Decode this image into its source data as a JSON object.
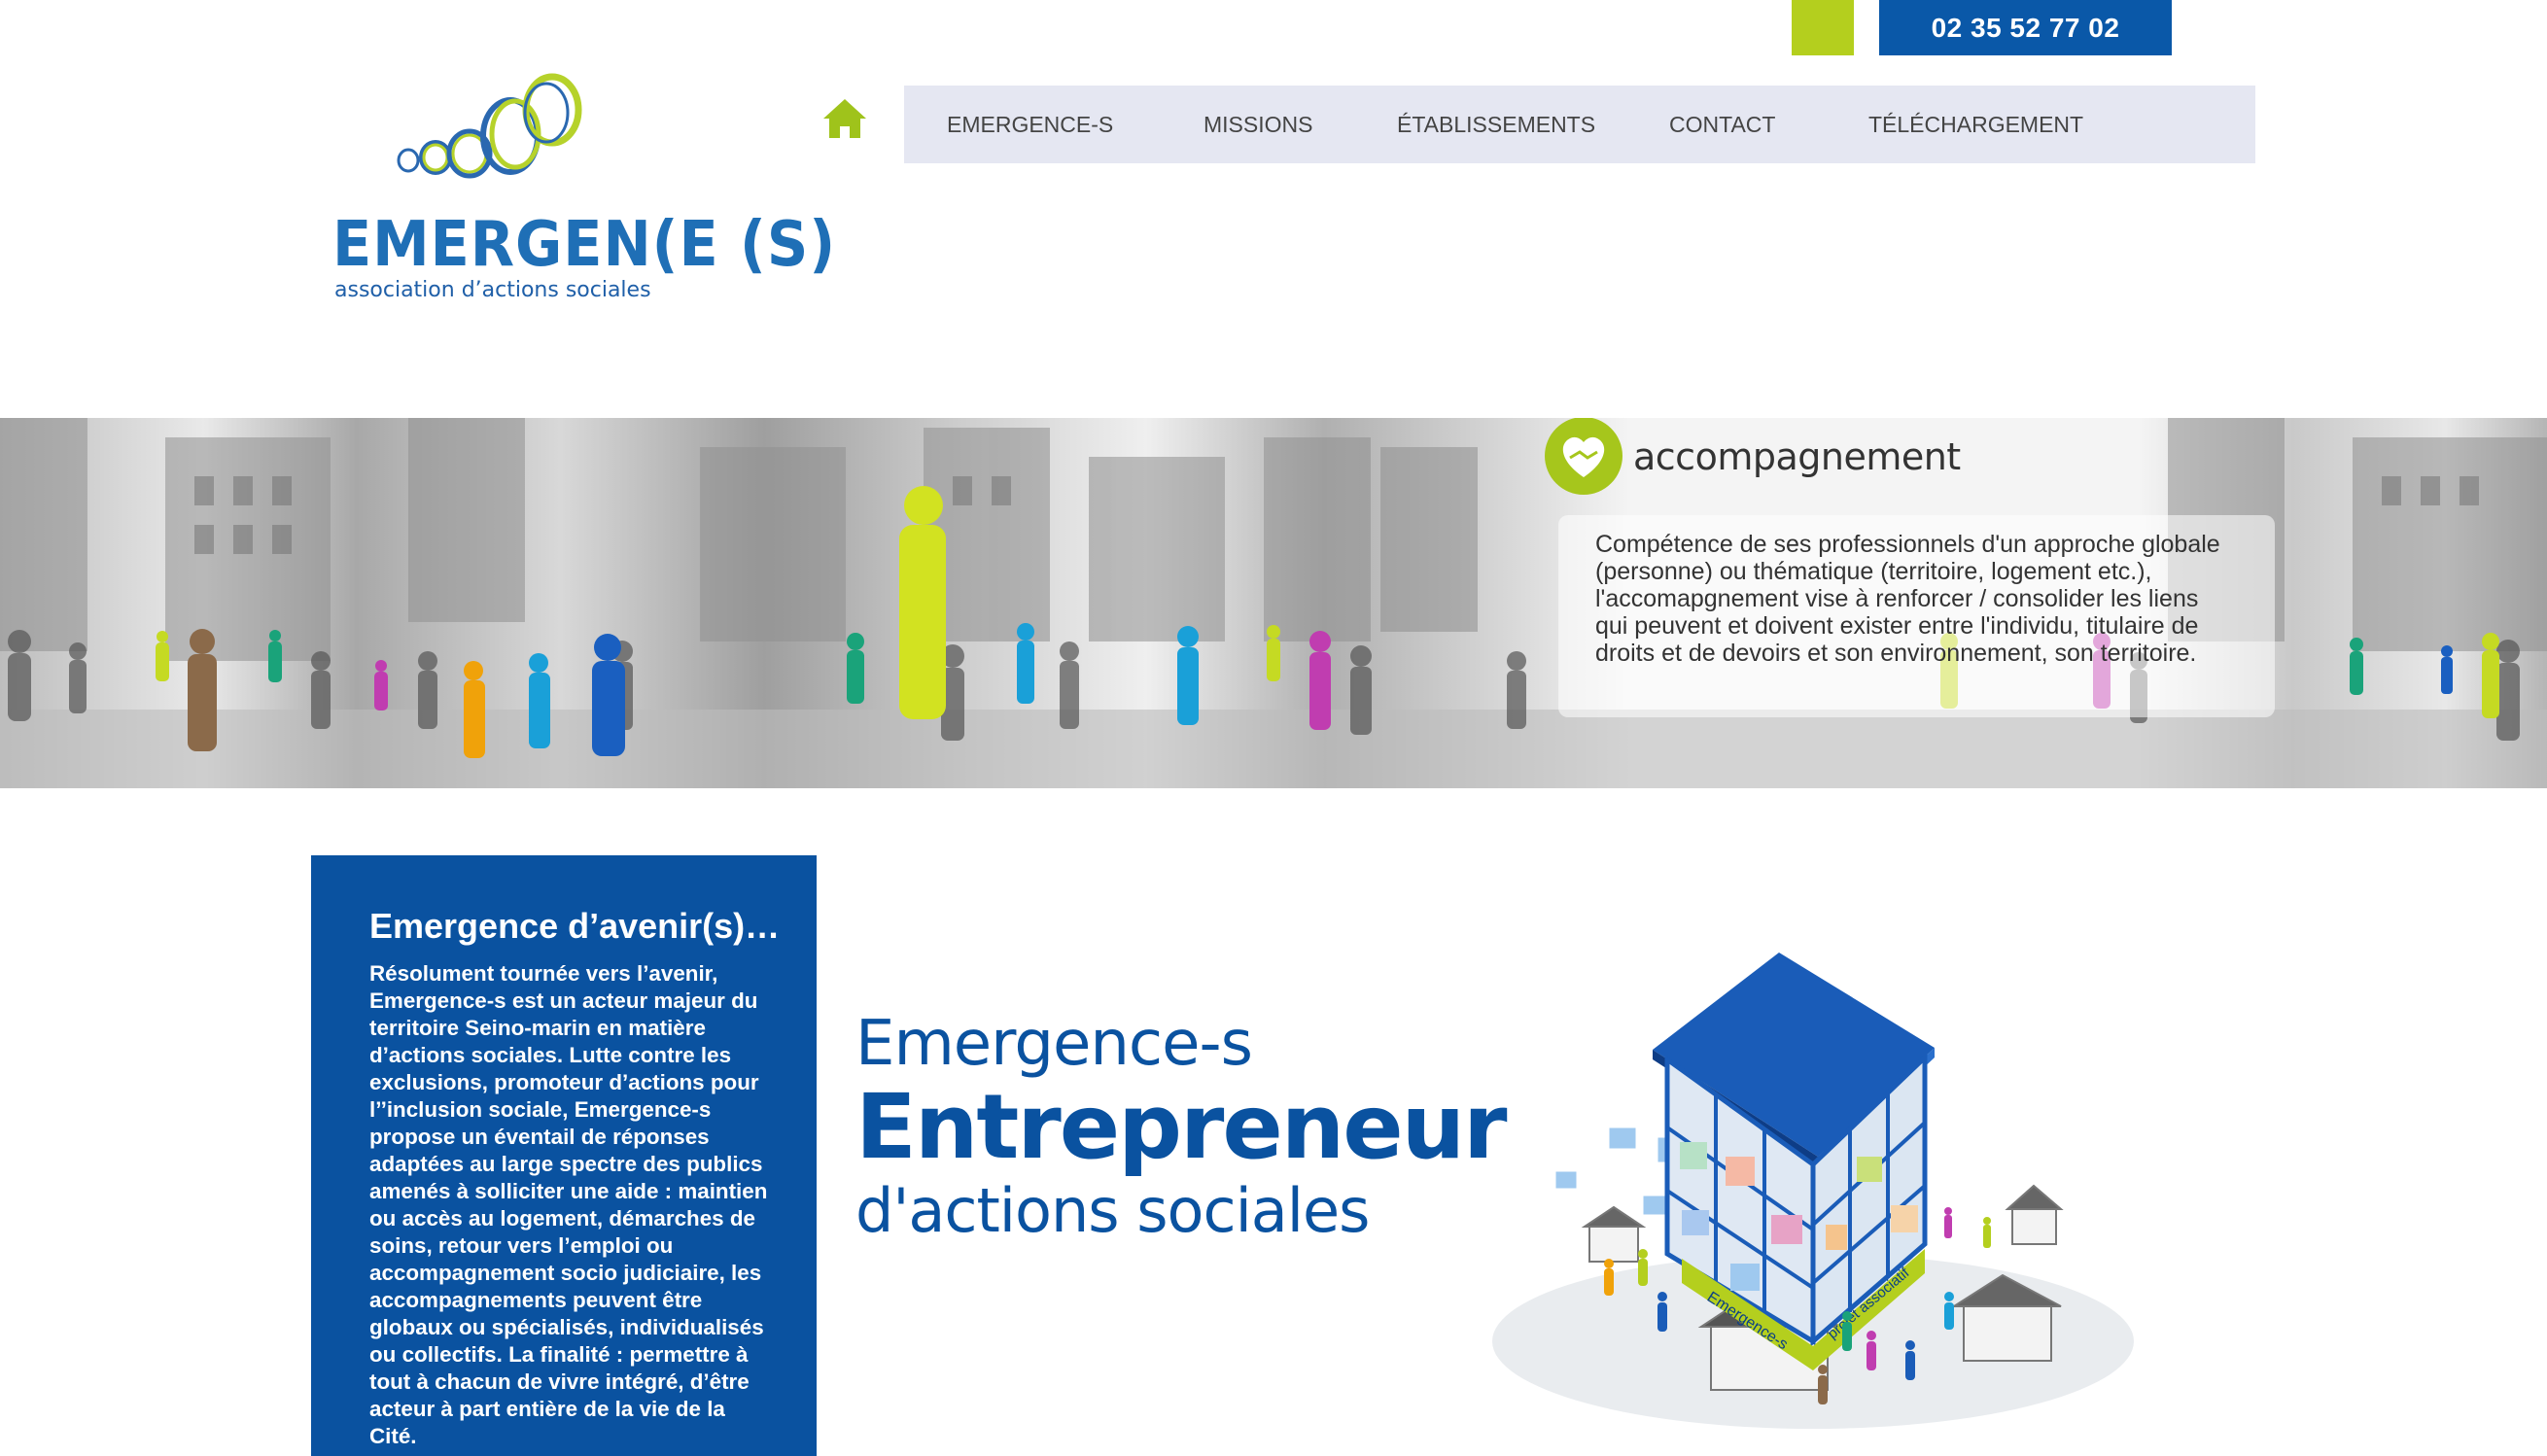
{
  "header": {
    "phone": "02 35 52 77 02",
    "accent_color": "#b4cf1e",
    "brand_blue": "#0a58a8"
  },
  "logo": {
    "wordmark": "EMERGEN(E (S)",
    "tagline": "association d’actions sociales"
  },
  "nav": {
    "home_icon": "home-icon",
    "items": [
      {
        "label": "EMERGENCE-S"
      },
      {
        "label": "MISSIONS"
      },
      {
        "label": "ÉTABLISSEMENTS"
      },
      {
        "label": "CONTACT"
      },
      {
        "label": "TÉLÉCHARGEMENT"
      }
    ]
  },
  "banner": {
    "icon": "handshake-heart-icon",
    "title": "accompagnement",
    "text": "Compétence de ses professionnels d'un approche globale (personne) ou thématique (territoire, logement etc.), l'accomapgnement vise à renforcer / consolider les liens qui peuvent et doivent exister entre l'individu, titulaire de droits et de devoirs et son environnement, son territoire."
  },
  "intro": {
    "title": "Emergence d’avenir(s)…",
    "text": "Résolument tournée vers l’avenir, Emergence-s est un acteur majeur du territoire Seino-marin en matière d’actions sociales. Lutte contre les exclusions, promoteur d’actions pour l’’inclusion sociale, Emergence-s propose un  éventail de réponses adaptées au large spectre des publics amenés à solliciter une aide : maintien ou accès au logement,  démarches de soins, retour vers l’emploi ou accompagnement socio judiciaire, les accompagnements peuvent être globaux ou spécialisés, individualisés ou collectifs. La finalité : permettre à tout à chacun de vivre intégré, d’être acteur à part entière de la vie de la Cité."
  },
  "slogan": {
    "line1": "Emergence-s",
    "line2": "Entrepreneur",
    "line3": "d'actions sociales"
  },
  "illustration": {
    "label1": "Emergence-s",
    "label2": "projet associatif"
  }
}
